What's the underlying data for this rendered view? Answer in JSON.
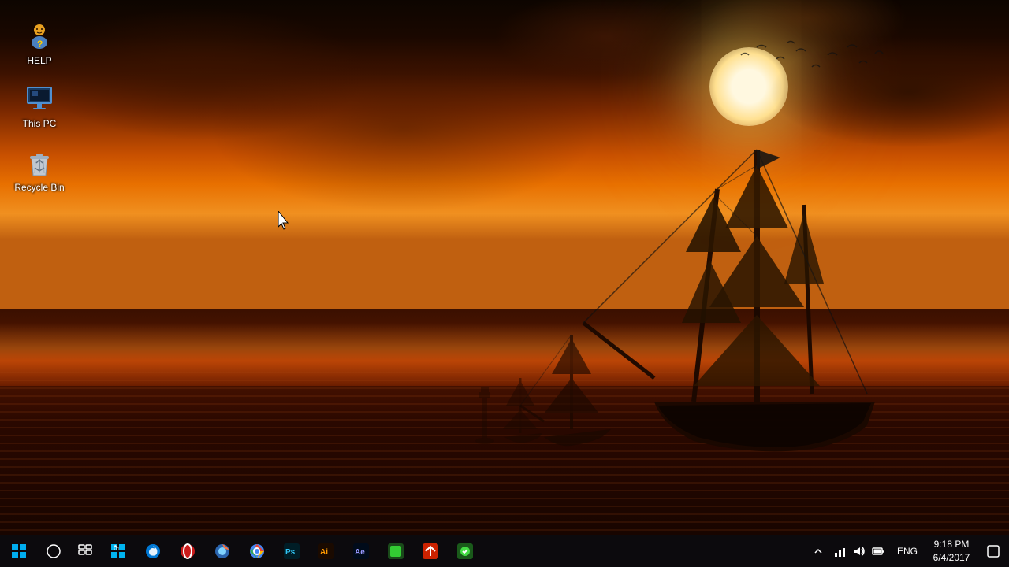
{
  "desktop": {
    "icons": [
      {
        "id": "help",
        "label": "HELP",
        "type": "help"
      },
      {
        "id": "this-pc",
        "label": "This PC",
        "type": "pc"
      },
      {
        "id": "recycle-bin",
        "label": "Recycle Bin",
        "type": "recycle"
      }
    ]
  },
  "taskbar": {
    "apps": [
      {
        "id": "start",
        "label": "Start"
      },
      {
        "id": "search",
        "label": "Search"
      },
      {
        "id": "store",
        "label": "Microsoft Store"
      },
      {
        "id": "edge",
        "label": "Microsoft Edge"
      },
      {
        "id": "opera",
        "label": "Opera"
      },
      {
        "id": "firefox",
        "label": "Firefox"
      },
      {
        "id": "chrome",
        "label": "Chrome"
      },
      {
        "id": "photoshop",
        "label": "Photoshop"
      },
      {
        "id": "illustrator",
        "label": "Illustrator"
      },
      {
        "id": "after-effects",
        "label": "After Effects"
      },
      {
        "id": "app1",
        "label": "App"
      },
      {
        "id": "app2",
        "label": "App"
      },
      {
        "id": "app3",
        "label": "App"
      }
    ],
    "tray": {
      "chevron": "^",
      "lang": "ENG",
      "time": "9:18 PM",
      "date": "6/4/2017",
      "icons": [
        "network",
        "volume",
        "battery"
      ]
    }
  }
}
